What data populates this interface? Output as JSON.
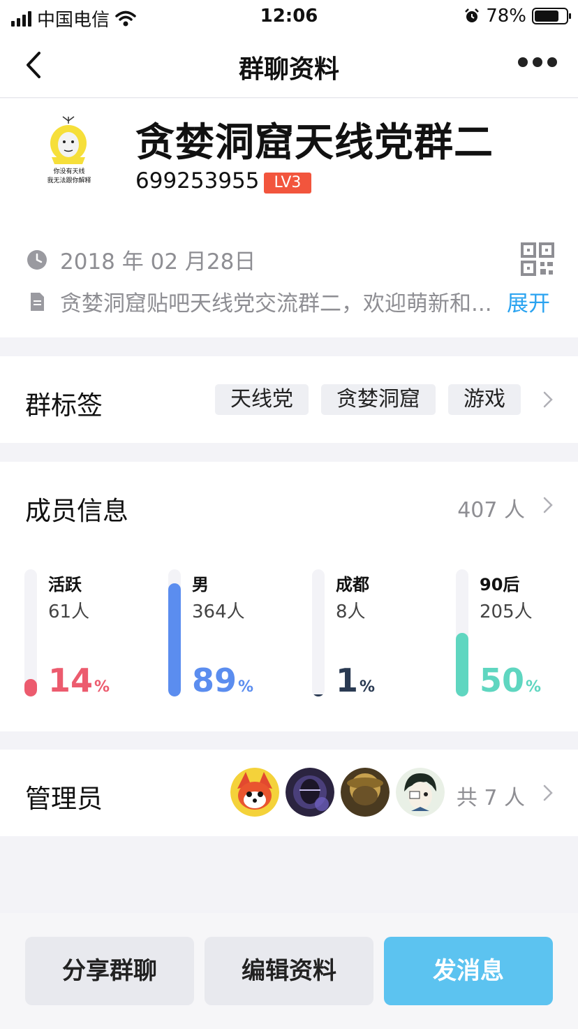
{
  "status_bar": {
    "carrier": "中国电信",
    "time": "12:06",
    "battery_percent": "78%",
    "battery_level": 0.78
  },
  "nav": {
    "title": "群聊资料",
    "back_icon": "chevron-left-icon",
    "more_icon": "more-dots-icon"
  },
  "group": {
    "avatar_text_line1": "你没有天线",
    "avatar_text_line2": "我无法跟你解释",
    "name": "贪婪洞窟天线党群二",
    "id": "699253955",
    "level": "LV3",
    "date": "2018 年 02 月28日",
    "description": "贪婪洞窟贴吧天线党交流群二，欢迎萌新和...",
    "expand_label": "展开"
  },
  "tags_section": {
    "title": "群标签",
    "tags": [
      "天线党",
      "贪婪洞窟",
      "游戏"
    ]
  },
  "members_section": {
    "title": "成员信息",
    "count": "407 人",
    "stats": [
      {
        "label": "活跃",
        "count": "61人",
        "percent": "14",
        "unit": "%",
        "level": 0.14,
        "color": "#ec5b6e"
      },
      {
        "label": "男",
        "count": "364人",
        "percent": "89",
        "unit": "%",
        "level": 0.89,
        "color": "#5b8def"
      },
      {
        "label": "成都",
        "count": "8人",
        "percent": "1",
        "unit": "%",
        "level": 0.01,
        "color": "#2a3a52"
      },
      {
        "label": "90后",
        "count": "205人",
        "percent": "50",
        "unit": "%",
        "level": 0.5,
        "color": "#5fd6c0"
      }
    ]
  },
  "admins_section": {
    "title": "管理员",
    "total": "共 7 人"
  },
  "actions": {
    "share": "分享群聊",
    "edit": "编辑资料",
    "send": "发消息"
  },
  "colors": {
    "accent": "#5cc3f0",
    "link": "#2aa3f0",
    "level_badge": "#f2553d"
  }
}
